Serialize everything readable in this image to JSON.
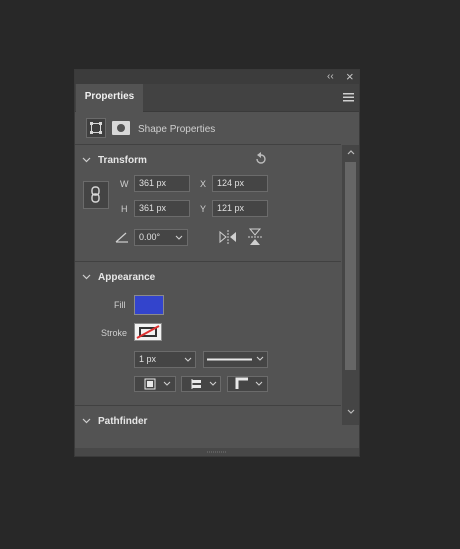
{
  "panel": {
    "tab_label": "Properties",
    "title_controls": {
      "collapse_glyph": "‹‹",
      "close_glyph": "×"
    },
    "menu_icon": "hamburger-menu-icon"
  },
  "shape_header": {
    "label": "Shape Properties"
  },
  "transform": {
    "title": "Transform",
    "w_label": "W",
    "w_value": "361 px",
    "x_label": "X",
    "x_value": "124 px",
    "h_label": "H",
    "h_value": "361 px",
    "y_label": "Y",
    "y_value": "121 px",
    "angle_value": "0.00°"
  },
  "appearance": {
    "title": "Appearance",
    "fill_label": "Fill",
    "fill_color": "#3344cc",
    "stroke_label": "Stroke",
    "stroke_color": "#e03030",
    "stroke_width": "1 px"
  },
  "pathfinder": {
    "title": "Pathfinder"
  }
}
